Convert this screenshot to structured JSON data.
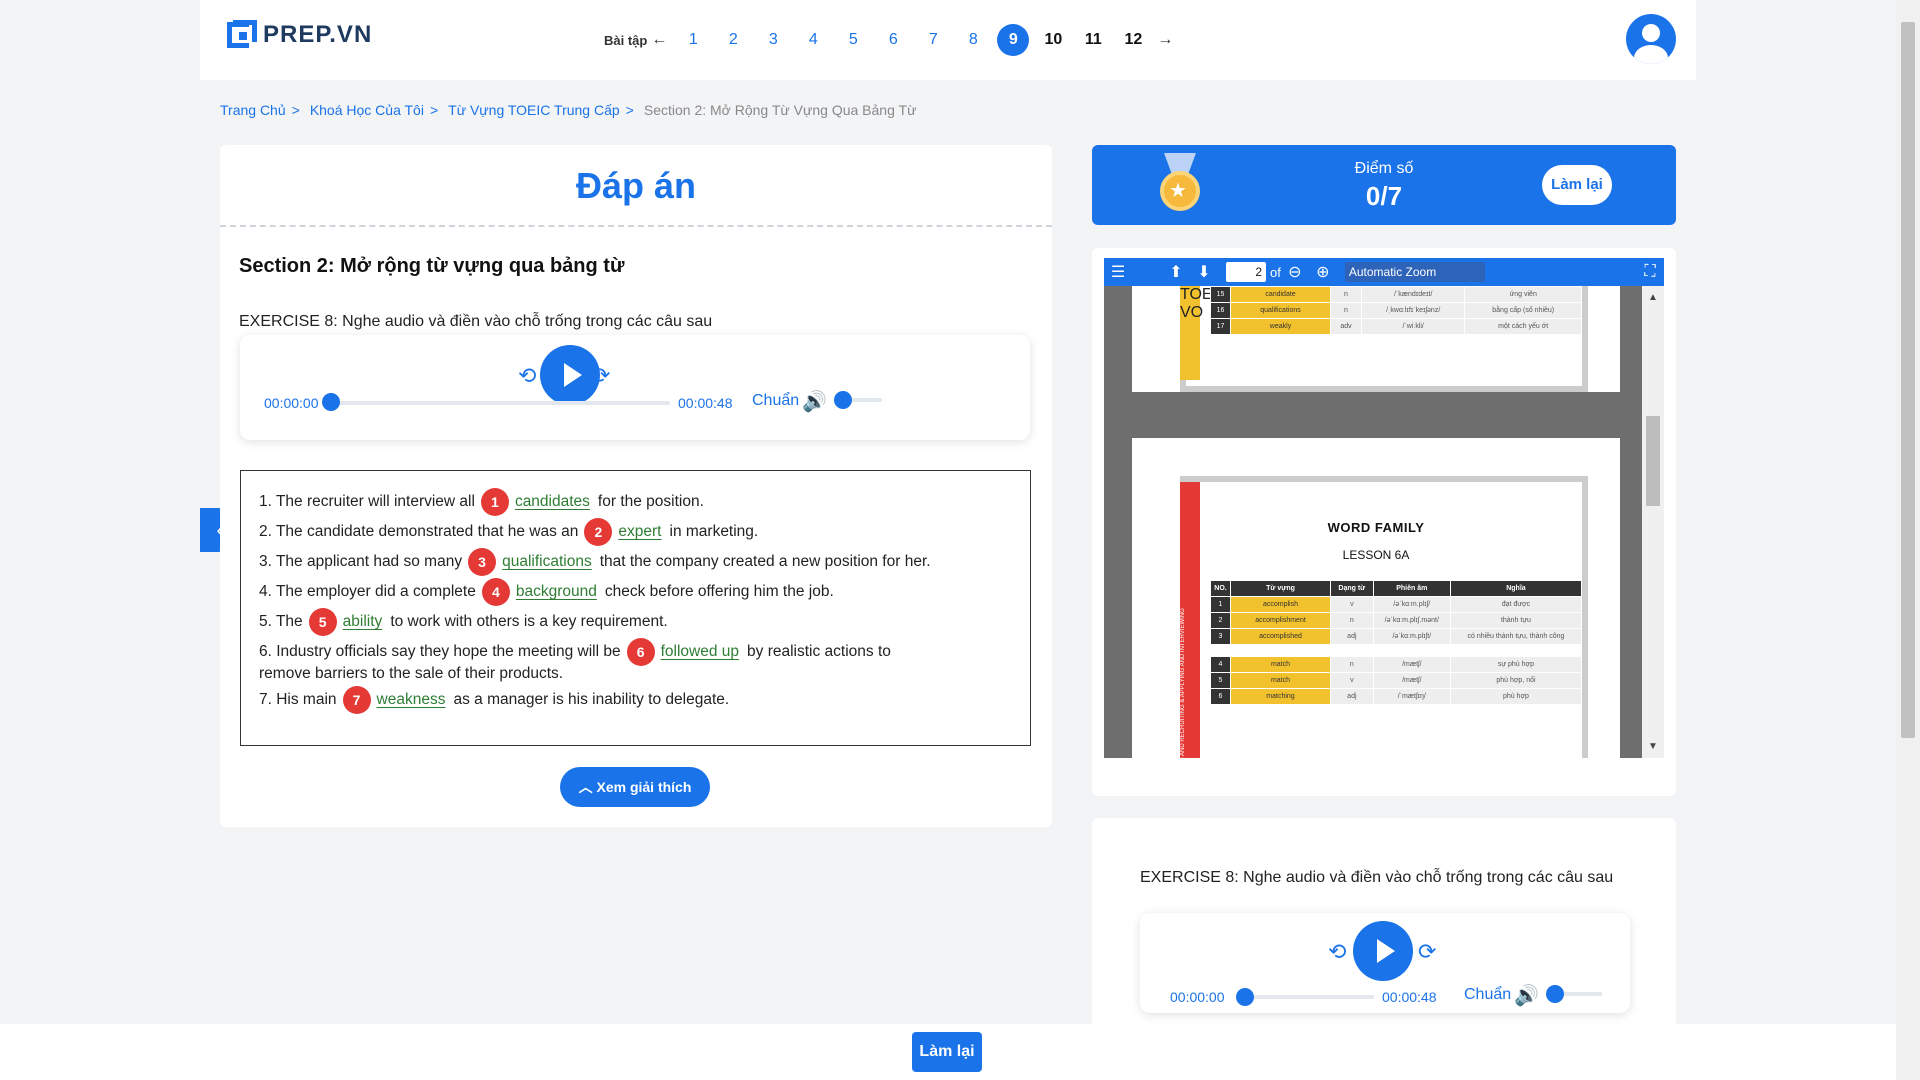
{
  "logo": {
    "text": "PREP.VN"
  },
  "pager": {
    "label": "Bài tập",
    "prev_arrow": "←",
    "next_arrow": "→",
    "items": [
      "1",
      "2",
      "3",
      "4",
      "5",
      "6",
      "7",
      "8",
      "9",
      "10",
      "11",
      "12"
    ],
    "active": "9"
  },
  "breadcrumb": [
    "Trang Chủ",
    "Khoá Học Của Tôi",
    "Từ Vựng TOEIC Trung Cấp",
    "Section 2: Mở Rộng Từ Vựng Qua Bảng Từ"
  ],
  "breadcrumb_sep": ">",
  "main": {
    "title": "Đáp án",
    "section": "Section 2: Mở rộng từ vựng qua bảng từ",
    "exercise": "EXERCISE 8: Nghe audio và điền vào chỗ trống trong các câu sau",
    "player": {
      "current": "00:00:00",
      "duration": "00:00:48",
      "speed": "Chuẩn"
    },
    "answers": [
      {
        "pre": "1. The recruiter will interview all",
        "n": "1",
        "ans": "candidates",
        "post": "for the position."
      },
      {
        "pre": "2. The candidate demonstrated that he was an",
        "n": "2",
        "ans": "expert",
        "post": "in marketing."
      },
      {
        "pre": "3. The applicant had so many",
        "n": "3",
        "ans": "qualifications",
        "post": "that the company created a new position for her."
      },
      {
        "pre": "4. The employer did a complete",
        "n": "4",
        "ans": "background",
        "post": "check before offering him the job."
      },
      {
        "pre": "5. The",
        "n": "5",
        "ans": "ability",
        "post": "to work with others is a key requirement."
      },
      {
        "pre": "6. Industry officials say they hope the meeting will be",
        "n": "6",
        "ans": "followed up",
        "post": "by realistic actions to",
        "cont": "remove barriers to the sale of their products."
      },
      {
        "pre": "7. His main",
        "n": "7",
        "ans": "weakness",
        "post": "as a manager is his inability to delegate."
      }
    ],
    "explain_button": "Xem giải thích"
  },
  "score": {
    "label": "Điểm số",
    "value": "0/7",
    "retry": "Làm lại"
  },
  "pdf": {
    "page": "2",
    "of": "of",
    "zoom": "Automatic Zoom",
    "top_rows": [
      {
        "no": "15",
        "word": "candidate",
        "pos": "n",
        "ipa": "/ˈkændɪdeɪt/",
        "mean": "ứng viên"
      },
      {
        "no": "16",
        "word": "qualifications",
        "pos": "n",
        "ipa": "/ˌkwɑːlɪfɪˈkeɪʃənz/",
        "mean": "bằng cấp (số nhiều)"
      },
      {
        "no": "17",
        "word": "weakly",
        "pos": "adv",
        "ipa": "/ˈwiːkli/",
        "mean": "một cách yếu ớt"
      }
    ],
    "side_label_1": "TOEIC VO",
    "wf_title": "WORD FAMILY",
    "lesson": "LESSON 6A",
    "side_label_2": "ING AND RECRUITING & APPLYING AND INTERVIEWING",
    "headers": [
      "NO.",
      "Từ vựng",
      "Dạng từ",
      "Phiên âm",
      "Nghĩa"
    ],
    "rows": [
      {
        "no": "1",
        "word": "accomplish",
        "pos": "v",
        "ipa": "/əˈkɑːm.plɪʃ/",
        "mean": "đạt được"
      },
      {
        "no": "2",
        "word": "accomplishment",
        "pos": "n",
        "ipa": "/əˈkɑːm.plɪʃ.mənt/",
        "mean": "thành tựu"
      },
      {
        "no": "3",
        "word": "accomplished",
        "pos": "adj",
        "ipa": "/əˈkɑːm.plɪʃt/",
        "mean": "có nhiều thành tựu, thành công"
      },
      {
        "no": "4",
        "word": "match",
        "pos": "n",
        "ipa": "/mætʃ/",
        "mean": "sự phù hợp"
      },
      {
        "no": "5",
        "word": "match",
        "pos": "v",
        "ipa": "/mætʃ/",
        "mean": "phù hợp, nối"
      },
      {
        "no": "6",
        "word": "matching",
        "pos": "adj",
        "ipa": "/ˈmætʃɪŋ/",
        "mean": "phù hợp"
      }
    ]
  },
  "exercise2": {
    "text": "EXERCISE 8: Nghe audio và điền vào chỗ trống trong các câu sau",
    "current": "00:00:00",
    "duration": "00:00:48",
    "speed": "Chuẩn"
  },
  "bottom": {
    "retry": "Làm lại"
  },
  "colors": {
    "primary": "#1a73e8",
    "answer": "#2e7d32",
    "badge": "#e53935"
  }
}
